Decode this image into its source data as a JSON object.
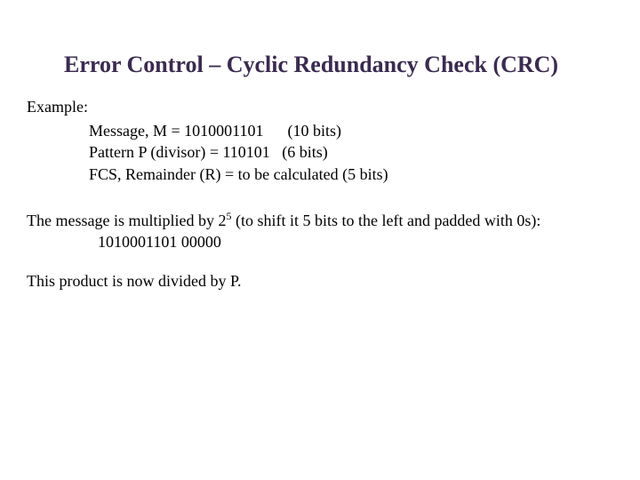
{
  "title": "Error Control – Cyclic Redundancy Check (CRC)",
  "example_label": "Example:",
  "lines": {
    "message": "Message, M = 1010001101      (10 bits)",
    "pattern": "Pattern P (divisor) = 110101   (6 bits)",
    "fcs": "FCS, Remainder (R) = to be calculated (5 bits)"
  },
  "para1_a": "The message is multiplied by 2",
  "para1_sup": "5",
  "para1_b": " (to shift it 5 bits to the left and padded with 0s):",
  "shifted": "1010001101 00000",
  "para2": "This product is now divided by P."
}
